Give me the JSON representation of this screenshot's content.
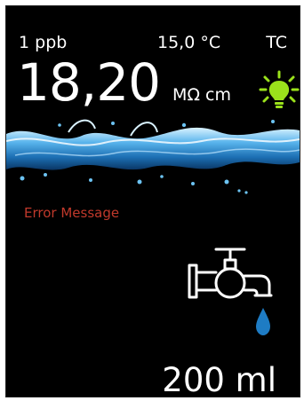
{
  "header": {
    "purity": "1 ppb",
    "temperature": "15,0 °C",
    "compensation": "TC"
  },
  "measurement": {
    "value": "18,20",
    "unit": "MΩ cm"
  },
  "status": {
    "lamp_icon": "light-bulb-icon",
    "lamp_color": "#9BE21B"
  },
  "error": {
    "message": "Error Message",
    "color": "#C0392B"
  },
  "dispense": {
    "faucet_icon": "water-tap-icon",
    "drop_color": "#1E7CC4",
    "volume": "200 ml"
  }
}
